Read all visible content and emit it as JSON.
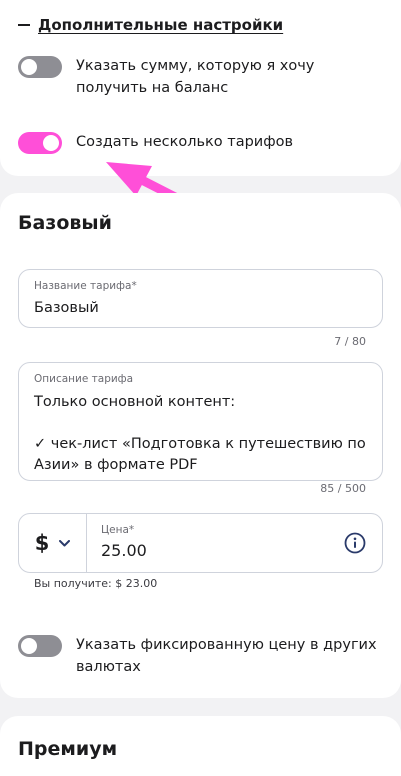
{
  "additional_settings": {
    "header_label": "Дополнительные настройки",
    "toggle_balance_label": "Указать сумму, которую я хочу получить на баланс",
    "toggle_balance_on": false,
    "toggle_multi_tier_label": "Создать несколько тарифов",
    "toggle_multi_tier_on": true
  },
  "tiers": [
    {
      "title": "Базовый",
      "name_field": {
        "label": "Название тарифа*",
        "value": "Базовый",
        "counter": "7 / 80"
      },
      "description_field": {
        "label": "Описание тарифа",
        "value": "Только основной контент:\n\n✓ чек-лист «Подготовка к путешествию по Азии» в формате PDF",
        "counter": "85 / 500"
      },
      "price_field": {
        "currency_symbol": "$",
        "label": "Цена*",
        "value": "25.00",
        "you_receive": "Вы получите: $ 23.00"
      },
      "fixed_price_toggle_label": "Указать фиксированную цену в других валютах",
      "fixed_price_toggle_on": false
    },
    {
      "title": "Премиум"
    }
  ],
  "colors": {
    "accent_pink": "#ff4fd8",
    "toggle_off": "#8e8e94",
    "arrow": "#ff4fd8"
  },
  "icons": {
    "collapse": "minus-icon",
    "currency_dropdown": "chevron-down-icon",
    "price_info": "info-icon"
  }
}
